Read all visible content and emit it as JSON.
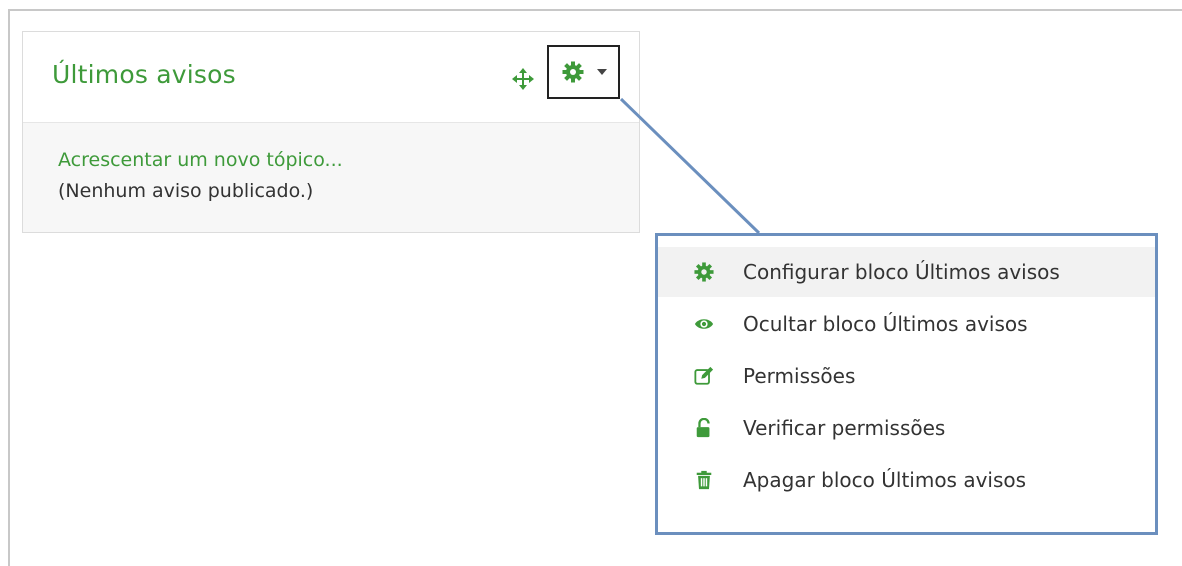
{
  "block": {
    "title": "Últimos avisos",
    "add_topic_label": "Acrescentar um novo tópico...",
    "empty_message": "(Nenhum aviso publicado.)",
    "move_icon": "move-arrows-icon",
    "actions_icon": "gear-icon"
  },
  "menu": {
    "items": [
      {
        "label": "Configurar bloco Últimos avisos",
        "icon": "gear-icon"
      },
      {
        "label": "Ocultar bloco Últimos avisos",
        "icon": "eye-icon"
      },
      {
        "label": "Permissões",
        "icon": "edit-icon"
      },
      {
        "label": "Verificar permissões",
        "icon": "unlock-icon"
      },
      {
        "label": "Apagar bloco Últimos avisos",
        "icon": "trash-icon"
      }
    ]
  },
  "colors": {
    "accent_green": "#3e9a3a",
    "callout_blue": "#6b8fbe",
    "text": "#333333"
  }
}
